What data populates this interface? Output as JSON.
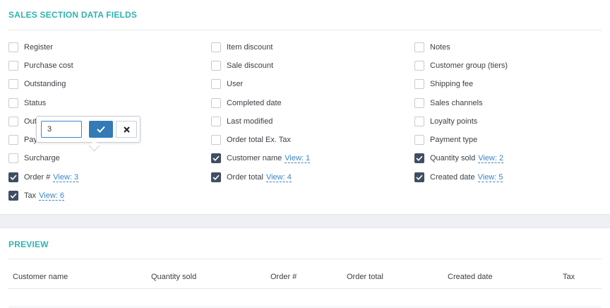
{
  "sales_section": {
    "title": "SALES SECTION DATA FIELDS",
    "fields": [
      {
        "label": "Register",
        "checked": false,
        "view": ""
      },
      {
        "label": "Purchase cost",
        "checked": false,
        "view": ""
      },
      {
        "label": "Outstanding",
        "checked": false,
        "view": ""
      },
      {
        "label": "Status",
        "checked": false,
        "view": ""
      },
      {
        "label": "Out",
        "checked": false,
        "view": ""
      },
      {
        "label": "Pay",
        "checked": false,
        "view": ""
      },
      {
        "label": "Surcharge",
        "checked": false,
        "view": ""
      },
      {
        "label": "Order #",
        "checked": true,
        "view": "View: 3"
      },
      {
        "label": "Tax",
        "checked": true,
        "view": "View: 6"
      },
      {
        "label": "Item discount",
        "checked": false,
        "view": ""
      },
      {
        "label": "Sale discount",
        "checked": false,
        "view": ""
      },
      {
        "label": "User",
        "checked": false,
        "view": ""
      },
      {
        "label": "Completed date",
        "checked": false,
        "view": ""
      },
      {
        "label": "Last modified",
        "checked": false,
        "view": ""
      },
      {
        "label": "Order total Ex. Tax",
        "checked": false,
        "view": ""
      },
      {
        "label": "Customer name",
        "checked": true,
        "view": "View: 1"
      },
      {
        "label": "Order total",
        "checked": true,
        "view": "View: 4"
      },
      {
        "label": "Notes",
        "checked": false,
        "view": ""
      },
      {
        "label": "Customer group (tiers)",
        "checked": false,
        "view": ""
      },
      {
        "label": "Shipping fee",
        "checked": false,
        "view": ""
      },
      {
        "label": "Sales channels",
        "checked": false,
        "view": ""
      },
      {
        "label": "Loyalty points",
        "checked": false,
        "view": ""
      },
      {
        "label": "Payment type",
        "checked": false,
        "view": ""
      },
      {
        "label": "Quantity sold",
        "checked": true,
        "view": "View: 2"
      },
      {
        "label": "Created date",
        "checked": true,
        "view": "View: 5"
      }
    ]
  },
  "popover": {
    "value": "3",
    "ok_icon": "check-icon",
    "cancel_icon": "close-icon"
  },
  "preview": {
    "title": "PREVIEW",
    "columns": [
      "Customer name",
      "Quantity sold",
      "Order #",
      "Order total",
      "Created date",
      "Tax"
    ]
  },
  "colors": {
    "accent": "#2fb3b0",
    "link": "#3a85c6",
    "checkbox_checked": "#3f4e63",
    "button_primary": "#337ab7"
  }
}
